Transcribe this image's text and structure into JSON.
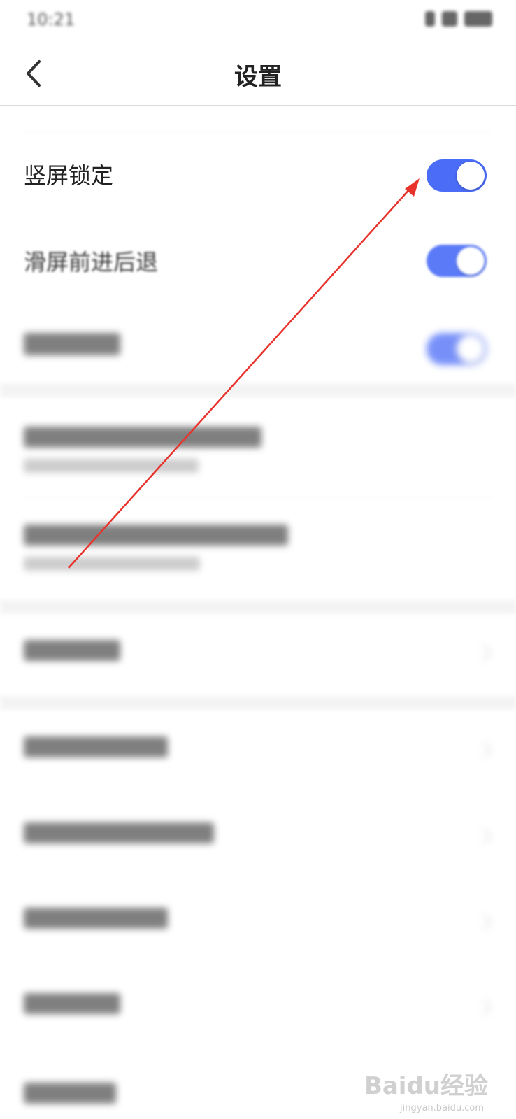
{
  "status": {
    "time": "10:21"
  },
  "nav": {
    "title": "设置"
  },
  "toggles": [
    {
      "label": "竖屏锁定",
      "on": true
    },
    {
      "label": "滑屏前进后退",
      "on": true
    },
    {
      "label": "",
      "on": true
    }
  ],
  "colors": {
    "accent": "#4a6cf7",
    "annotation_arrow": "#e8322b"
  },
  "watermark": {
    "brand": "Baidu经验",
    "url": "jingyan.baidu.com"
  }
}
